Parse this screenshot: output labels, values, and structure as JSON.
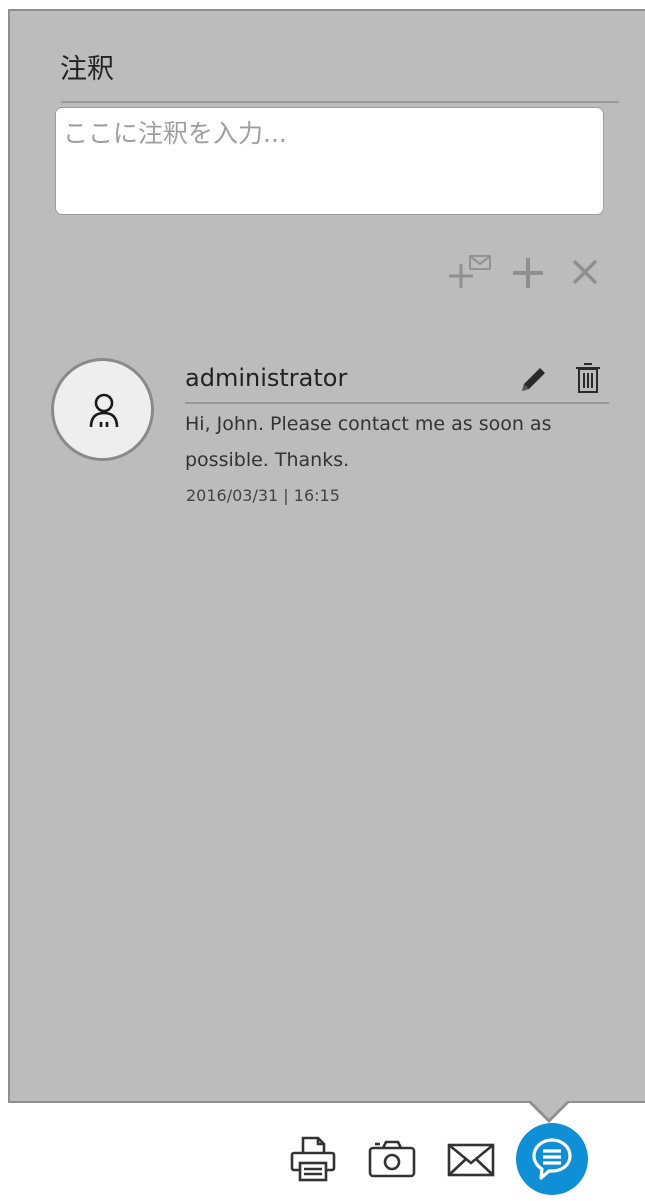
{
  "panel": {
    "title": "注釈",
    "input": {
      "value": "",
      "placeholder": "ここに注釈を入力..."
    },
    "actions": {
      "add_and_email_icon": "plus-envelope-icon",
      "add_icon": "plus-icon",
      "clear_icon": "close-icon"
    }
  },
  "annotations": [
    {
      "author": "administrator",
      "message": "Hi, John. Please contact me as soon as possible. Thanks.",
      "timestamp": "2016/03/31 | 16:15",
      "avatar_icon": "user-icon",
      "edit_icon": "pencil-icon",
      "delete_icon": "trash-icon"
    }
  ],
  "toolbar": {
    "print_icon": "printer-icon",
    "snapshot_icon": "camera-icon",
    "email_icon": "envelope-icon",
    "annotations_icon": "speech-bubble-icon"
  },
  "colors": {
    "panel_background": "#bcbcbc",
    "icon_muted": "#8f8f8f",
    "accent": "#0f8fd6"
  }
}
